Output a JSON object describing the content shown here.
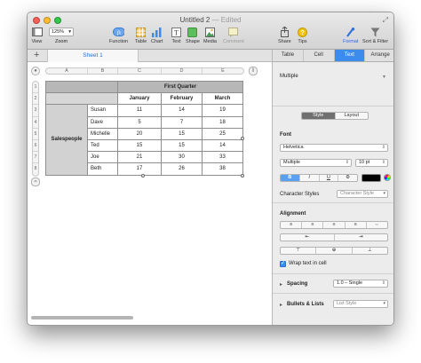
{
  "window": {
    "title": "Untitled 2",
    "edited_label": "— Edited"
  },
  "toolbar": {
    "view_label": "View",
    "zoom_value": "125%",
    "zoom_label": "Zoom",
    "function_label": "Function",
    "table_label": "Table",
    "chart_label": "Chart",
    "text_label": "Text",
    "shape_label": "Shape",
    "media_label": "Media",
    "comment_label": "Comment",
    "share_label": "Share",
    "tips_label": "Tips",
    "format_label": "Format",
    "sort_filter_label": "Sort & Filter"
  },
  "sheet_tabs": {
    "add_label": "+",
    "active_sheet": "Sheet 1"
  },
  "grid": {
    "columns": [
      "A",
      "B",
      "C",
      "D",
      "E"
    ],
    "rows": [
      "1",
      "2",
      "3",
      "4",
      "5",
      "6",
      "7",
      "8"
    ]
  },
  "table": {
    "quarter_header": "First Quarter",
    "months": [
      "January",
      "February",
      "March"
    ],
    "group_label": "Salespeople",
    "people": [
      {
        "name": "Susan",
        "values": [
          "11",
          "14",
          "19"
        ]
      },
      {
        "name": "Dave",
        "values": [
          "5",
          "7",
          "18"
        ]
      },
      {
        "name": "Michelle",
        "values": [
          "20",
          "15",
          "25"
        ]
      },
      {
        "name": "Ted",
        "values": [
          "15",
          "15",
          "14"
        ]
      },
      {
        "name": "Joe",
        "values": [
          "21",
          "30",
          "33"
        ]
      },
      {
        "name": "Beth",
        "values": [
          "17",
          "26",
          "38"
        ]
      }
    ]
  },
  "inspector": {
    "tabs": [
      "Table",
      "Cell",
      "Text",
      "Arrange"
    ],
    "active_tab": "Text",
    "paragraph_style": "Multiple",
    "style_toggle": [
      "Style",
      "Layout"
    ],
    "font_heading": "Font",
    "font_family": "Helvetica",
    "font_typeface": "Multiple",
    "font_size": "10 pt",
    "style_buttons": [
      "B",
      "I",
      "U",
      "⚙"
    ],
    "character_styles_label": "Character Styles",
    "character_style_value": "Character Style",
    "alignment_heading": "Alignment",
    "wrap_text_label": "Wrap text in cell",
    "spacing_label": "Spacing",
    "spacing_value": "1.0 – Single",
    "bullets_label": "Bullets & Lists",
    "bullets_value": "List Style"
  },
  "colors": {
    "accent": "#3d8bea",
    "header_fill": "#b7b7b7",
    "label_fill": "#d2d2d2"
  }
}
